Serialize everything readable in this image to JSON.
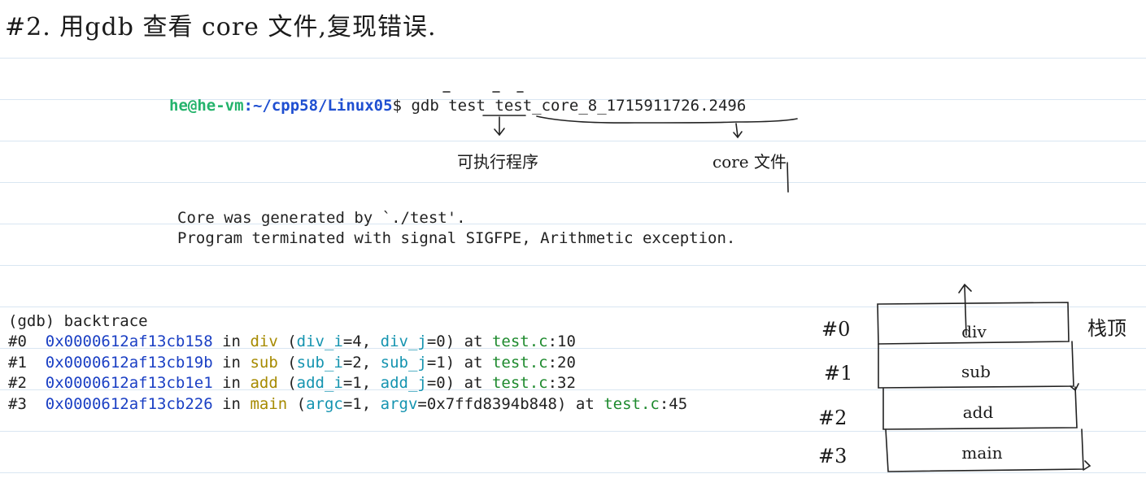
{
  "title": "#2. 用gdb 查看 core 文件,复现错误.",
  "command": {
    "user": "he@he-vm",
    "path": ":~/cpp58/Linux05",
    "dollar": "$ ",
    "gdb": "gdb ",
    "program": "test",
    "corefile": " test_core_8_1715911726.2496"
  },
  "annotations": {
    "executable": "可执行程序",
    "core_file": "core 文件"
  },
  "core_msg": {
    "line1": "Core was generated by `./test'.",
    "line2": "Program terminated with signal SIGFPE, Arithmetic exception."
  },
  "backtrace": {
    "cmd": "(gdb) backtrace",
    "frames": [
      {
        "num": "#0",
        "addr": "0x0000612af13cb158",
        "in": " in ",
        "fn": "div",
        "args": [
          {
            "name": "div_i",
            "val": "4"
          },
          {
            "name": "div_j",
            "val": "0"
          }
        ],
        "at": " at ",
        "file": "test.c",
        "line": "10"
      },
      {
        "num": "#1",
        "addr": "0x0000612af13cb19b",
        "in": " in ",
        "fn": "sub",
        "args": [
          {
            "name": "sub_i",
            "val": "2"
          },
          {
            "name": "sub_j",
            "val": "1"
          }
        ],
        "at": " at ",
        "file": "test.c",
        "line": "20"
      },
      {
        "num": "#2",
        "addr": "0x0000612af13cb1e1",
        "in": " in ",
        "fn": "add",
        "args": [
          {
            "name": "add_i",
            "val": "1"
          },
          {
            "name": "add_j",
            "val": "0"
          }
        ],
        "at": " at ",
        "file": "test.c",
        "line": "32"
      },
      {
        "num": "#3",
        "addr": "0x0000612af13cb226",
        "in": " in ",
        "fn": "main",
        "args": [
          {
            "name": "argc",
            "val": "1"
          },
          {
            "name": "argv",
            "val": "0x7ffd8394b848"
          }
        ],
        "at": " at ",
        "file": "test.c",
        "line": "45"
      }
    ]
  },
  "stack": {
    "top_label": "栈顶",
    "frames": [
      {
        "num": "#0",
        "name": "div"
      },
      {
        "num": "#1",
        "name": "sub"
      },
      {
        "num": "#2",
        "name": "add"
      },
      {
        "num": "#3",
        "name": "main"
      }
    ]
  }
}
